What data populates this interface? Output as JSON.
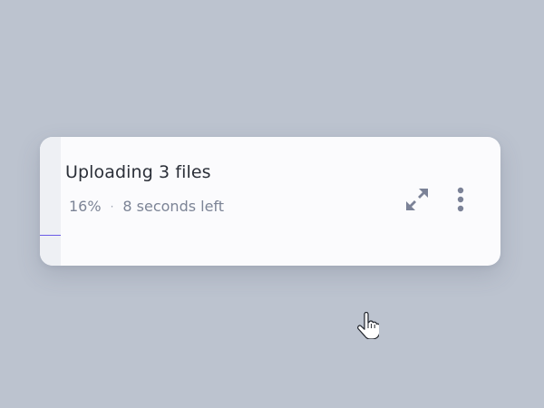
{
  "upload": {
    "title": "Uploading 3 files",
    "percent_label": "16%",
    "separator": "·",
    "time_left": "8 seconds left",
    "progress": 0.045
  },
  "actions": {
    "expand_icon": "expand-arrows-icon",
    "more_icon": "more-vertical-icon"
  },
  "colors": {
    "background": "#bcc3cf",
    "card": "#fbfbfd",
    "accent": "#6b5ce7",
    "icon": "#7b8297"
  }
}
